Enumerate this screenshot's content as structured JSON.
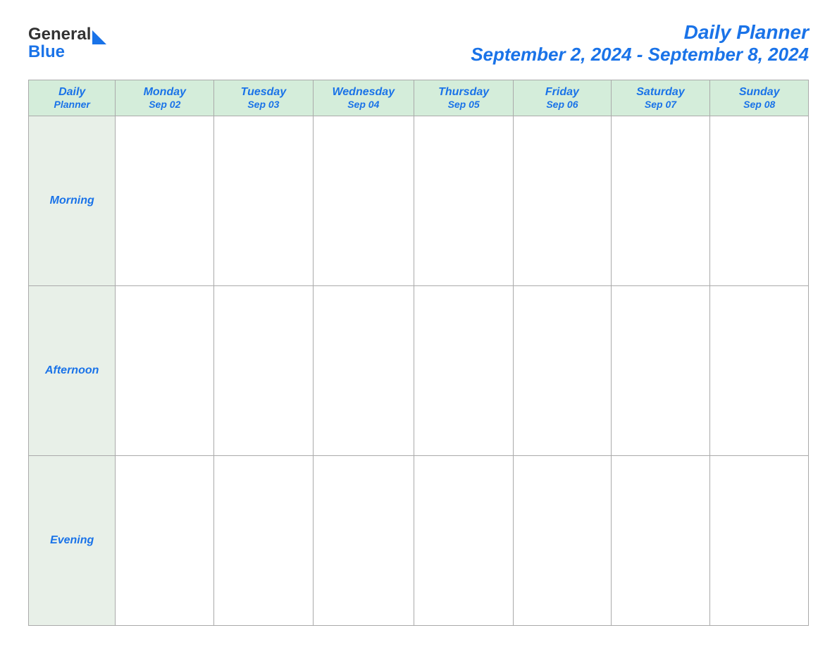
{
  "logo": {
    "text_general": "General",
    "text_blue": "Blue"
  },
  "header": {
    "title": "Daily Planner",
    "subtitle": "September 2, 2024 - September 8, 2024"
  },
  "table": {
    "label_column": {
      "header_line1": "Daily",
      "header_line2": "Planner"
    },
    "days": [
      {
        "name": "Monday",
        "date": "Sep 02"
      },
      {
        "name": "Tuesday",
        "date": "Sep 03"
      },
      {
        "name": "Wednesday",
        "date": "Sep 04"
      },
      {
        "name": "Thursday",
        "date": "Sep 05"
      },
      {
        "name": "Friday",
        "date": "Sep 06"
      },
      {
        "name": "Saturday",
        "date": "Sep 07"
      },
      {
        "name": "Sunday",
        "date": "Sep 08"
      }
    ],
    "time_slots": [
      "Morning",
      "Afternoon",
      "Evening"
    ]
  }
}
